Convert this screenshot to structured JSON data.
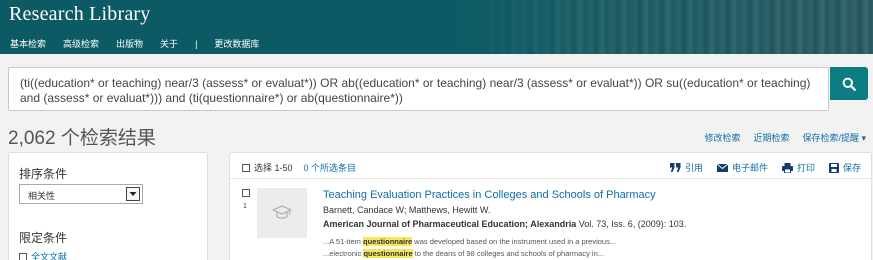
{
  "header": {
    "brand": "Research Library",
    "nav": [
      "基本检索",
      "高级检索",
      "出版物",
      "关于"
    ],
    "nav_separator": "|",
    "nav_change_db": "更改数据库",
    "background": "#0c5b64"
  },
  "search": {
    "query": "(ti((education* or teaching) near/3 (assess* or evaluat*)) OR ab((education* or teaching) near/3 (assess* or evaluat*)) OR su((education* or teaching) and (assess* or evaluat*))) and (ti(questionnaire*) or ab(questionnaire*))",
    "button_icon": "search-icon",
    "button_color": "#0d7d83"
  },
  "results_header": {
    "count": "2,062 个检索结果",
    "links": [
      "修改检索",
      "近期检索",
      "保存检索/提醒 ▾"
    ]
  },
  "sidebar": {
    "sort_title": "排序条件",
    "sort_value": "相关性",
    "limit_title": "限定条件",
    "fulltext_label": "全文文献"
  },
  "results_toolbar": {
    "select_label": "选择 1-50",
    "selected_label": "0 个所选条目",
    "tools": [
      {
        "icon": "quote-icon",
        "label": "引用"
      },
      {
        "icon": "email-icon",
        "label": "电子邮件"
      },
      {
        "icon": "print-icon",
        "label": "打印"
      },
      {
        "icon": "save-icon",
        "label": "保存"
      }
    ]
  },
  "results": [
    {
      "number": "1",
      "title": "Teaching Evaluation Practices in Colleges and Schools of Pharmacy",
      "authors": "Barnett, Candace W; Matthews, Hewitt W.",
      "journal": "American Journal of Pharmaceutical Education; Alexandria",
      "source_details": " Vol. 73, Iss. 6,  (2009): 103.",
      "snippet1_before": "...A 51-item ",
      "snippet1_highlight": "questionnaire",
      "snippet1_after": " was developed based on the instrument used in a previous...",
      "snippet2_before": "...electronic ",
      "snippet2_highlight": "questionnaire",
      "snippet2_after": " to the deans of 98 colleges and schools of pharmacy in..."
    }
  ],
  "colors": {
    "link": "#0d6fa8",
    "highlight": "#f7e65a"
  }
}
